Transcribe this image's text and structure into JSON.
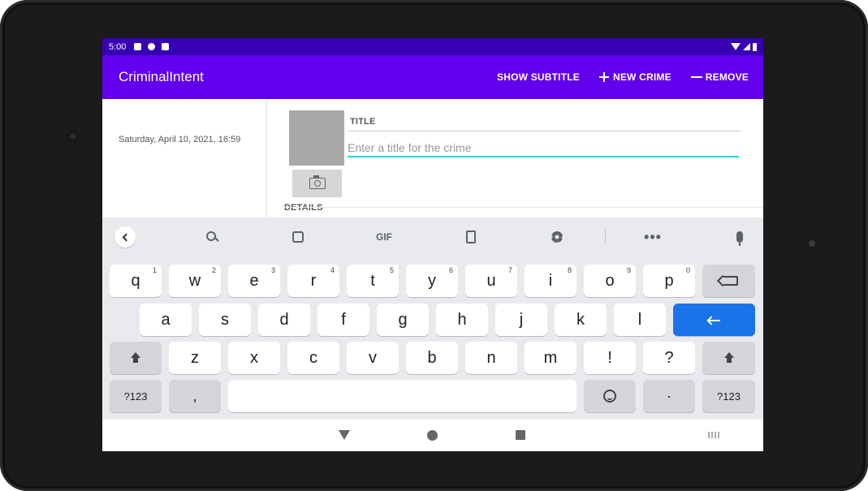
{
  "status_bar": {
    "time": "5:00"
  },
  "app_bar": {
    "title": "CriminalIntent",
    "show_subtitle_label": "SHOW SUBTITLE",
    "new_crime_label": "NEW CRIME",
    "remove_label": "REMOVE"
  },
  "crime_list": {
    "items": [
      {
        "date": "Saturday, April 10, 2021, 16:59"
      }
    ]
  },
  "crime_detail": {
    "title_label": "TITLE",
    "title_placeholder": "Enter a title for the crime",
    "title_value": "",
    "details_label": "DETAILS"
  },
  "keyboard": {
    "toolbar": {
      "gif_label": "GIF",
      "more_label": "•••"
    },
    "row1": [
      {
        "key": "q",
        "sup": "1"
      },
      {
        "key": "w",
        "sup": "2"
      },
      {
        "key": "e",
        "sup": "3"
      },
      {
        "key": "r",
        "sup": "4"
      },
      {
        "key": "t",
        "sup": "5"
      },
      {
        "key": "y",
        "sup": "6"
      },
      {
        "key": "u",
        "sup": "7"
      },
      {
        "key": "i",
        "sup": "8"
      },
      {
        "key": "o",
        "sup": "9"
      },
      {
        "key": "p",
        "sup": "0"
      }
    ],
    "row2": [
      "a",
      "s",
      "d",
      "f",
      "g",
      "h",
      "j",
      "k",
      "l"
    ],
    "row3": [
      "z",
      "x",
      "c",
      "v",
      "b",
      "n",
      "m",
      "!",
      "?"
    ],
    "symbols_label": "?123",
    "comma_label": ",",
    "period_label": "·"
  },
  "colors": {
    "status_bar": "#3700b3",
    "app_bar": "#6200ee",
    "input_underline": "#03dac5",
    "enter_key": "#1a73e8"
  }
}
